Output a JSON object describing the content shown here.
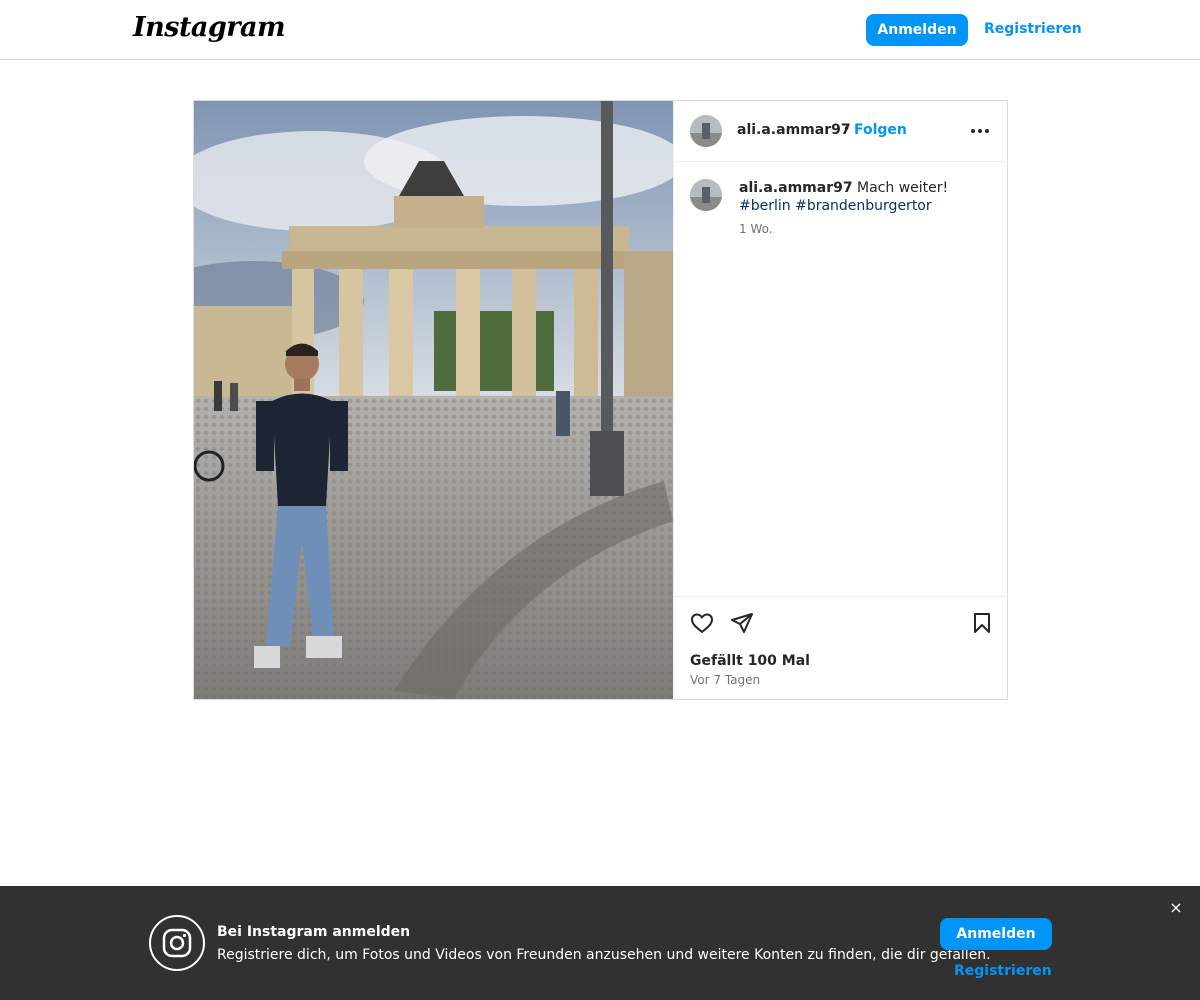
{
  "header": {
    "logo_text": "Instagram",
    "login_label": "Anmelden",
    "register_label": "Registrieren"
  },
  "post": {
    "username": "ali.a.ammar97",
    "separator": "•",
    "follow_label": "Folgen",
    "caption": {
      "username": "ali.a.ammar97",
      "text": "Mach weiter!",
      "hashtags": [
        "#berlin",
        "#brandenburgertor"
      ]
    },
    "relative_time": "1 Wo.",
    "likes_text": "Gefällt 100 Mal",
    "posted_ago": "Vor 7 Tagen"
  },
  "banner": {
    "title": "Bei Instagram anmelden",
    "text": "Registriere dich, um Fotos und Videos von Freunden anzusehen und weitere Konten zu finden, die dir gefallen.",
    "login_label": "Anmelden",
    "register_label": "Registrieren",
    "close_symbol": "×"
  },
  "colors": {
    "brand_blue": "#0095f6",
    "hashtag": "#00376b",
    "banner_bg": "#313131"
  },
  "icons": [
    "more-icon",
    "heart-icon",
    "share-icon",
    "bookmark-icon",
    "instagram-glyph-icon",
    "close-icon"
  ]
}
